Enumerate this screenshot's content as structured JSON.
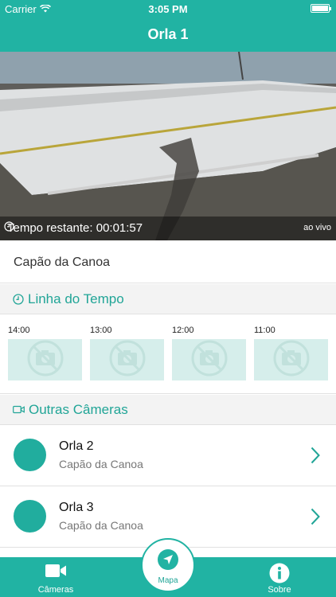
{
  "status_bar": {
    "carrier": "Carrier",
    "time": "3:05 PM"
  },
  "header": {
    "title": "Orla 1"
  },
  "video": {
    "remaining_label": "Tempo restante: 00:01:57",
    "live_label": "ao vivo"
  },
  "location": {
    "name": "Capão da Canoa"
  },
  "timeline": {
    "title": "Linha do Tempo",
    "items": [
      {
        "time": "14:00"
      },
      {
        "time": "13:00"
      },
      {
        "time": "12:00"
      },
      {
        "time": "11:00"
      }
    ]
  },
  "other_cameras": {
    "title": "Outras Câmeras",
    "items": [
      {
        "name": "Orla 2",
        "location": "Capão da Canoa"
      },
      {
        "name": "Orla 3",
        "location": "Capão da Canoa"
      }
    ]
  },
  "tabbar": {
    "cameras_label": "Câmeras",
    "map_label": "Mapa",
    "about_label": "Sobre"
  },
  "colors": {
    "accent": "#21b3a3",
    "accent_text": "#21a597",
    "thumb_bg": "#d6eeeb"
  }
}
